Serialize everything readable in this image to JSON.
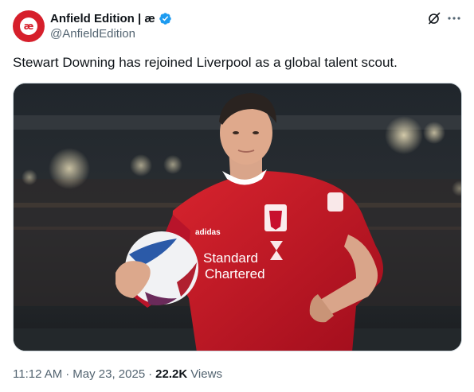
{
  "account": {
    "display_name": "Anfield Edition | æ",
    "handle": "@AnfieldEdition",
    "avatar_glyph": "æ",
    "verified": true,
    "brand_color": "#d61f2b",
    "verified_color": "#1d9bf0"
  },
  "header_actions": {
    "grok_icon": "grok-icon",
    "more_icon": "more-icon"
  },
  "tweet": {
    "text": "Stewart Downing has rejoined Liverpool as a global talent scout.",
    "media": {
      "sponsor_line1": "Standard",
      "sponsor_line2": "Chartered",
      "kit_brand": "adidas",
      "shirt_color": "#c8102e"
    }
  },
  "meta": {
    "time": "11:12 AM",
    "separator": "·",
    "date": "May 23, 2025",
    "views_count": "22.2K",
    "views_label": "Views"
  }
}
